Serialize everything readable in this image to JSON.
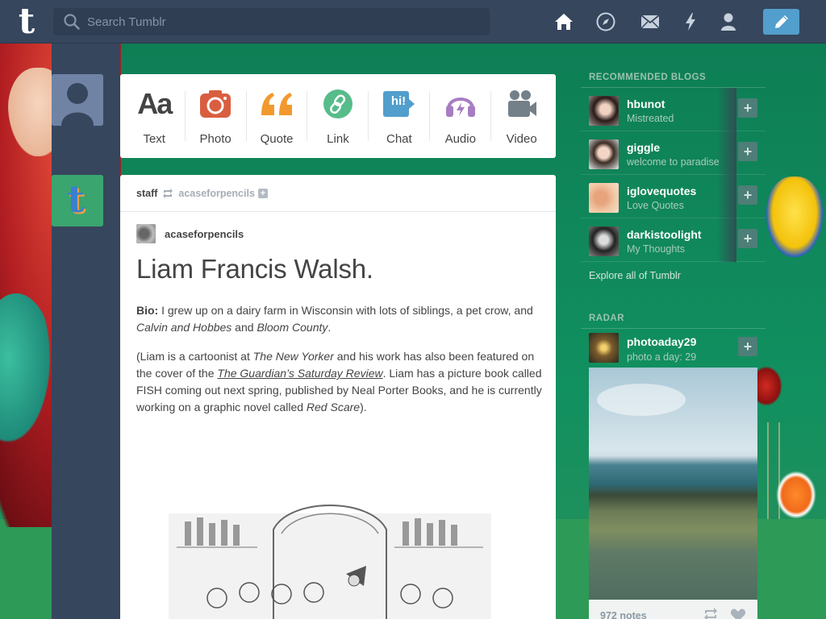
{
  "search": {
    "placeholder": "Search Tumblr"
  },
  "nav": {
    "icons": [
      "home-icon",
      "explore-icon",
      "inbox-icon",
      "activity-icon",
      "account-icon"
    ],
    "compose": "pencil-icon"
  },
  "post_types": [
    {
      "label": "Text",
      "icon": "Aa",
      "color": "#444444"
    },
    {
      "label": "Photo",
      "icon": "camera-icon",
      "color": "#d95e40"
    },
    {
      "label": "Quote",
      "icon": "quote-icon",
      "color": "#f2992e"
    },
    {
      "label": "Link",
      "icon": "link-icon",
      "color": "#56bc8a"
    },
    {
      "label": "Chat",
      "icon": "hi!",
      "color": "#529ecc"
    },
    {
      "label": "Audio",
      "icon": "headphones-icon",
      "color": "#a77dc2"
    },
    {
      "label": "Video",
      "icon": "video-camera-icon",
      "color": "#748089"
    }
  ],
  "post": {
    "reblogger": "staff",
    "reblogged_from": "acaseforpencils",
    "source": "acaseforpencils",
    "title": "Liam Francis Walsh.",
    "bio_label": "Bio:",
    "bio_text": " I grew up on a dairy farm in Wisconsin with lots of siblings, a pet crow, and ",
    "bio_italic1": "Calvin and Hobbes",
    "bio_and": " and ",
    "bio_italic2": "Bloom County",
    "bio_end": ".",
    "p2_a": "(Liam is a cartoonist at ",
    "p2_newyorker": "The New Yorker",
    "p2_b": " and his work has also been featured on the cover of the ",
    "p2_guardian": "The Guardian’s Saturday Review",
    "p2_c": ". Liam has a picture book called FISH coming out next spring, published by Neal Porter Books, and he is currently working on a graphic novel called ",
    "p2_redscare": "Red Scare",
    "p2_d": ")."
  },
  "sidebar": {
    "recommended_title": "RECOMMENDED BLOGS",
    "blogs": [
      {
        "name": "hbunot",
        "subtitle": "Mistreated"
      },
      {
        "name": "giggle",
        "subtitle": "welcome to paradise"
      },
      {
        "name": "iglovequotes",
        "subtitle": "Love Quotes"
      },
      {
        "name": "darkistoolight",
        "subtitle": "My Thoughts"
      }
    ],
    "explore_link": "Explore all of Tumblr",
    "radar_title": "RADAR",
    "radar": {
      "name": "photoaday29",
      "subtitle": "photo a day: 29",
      "notes": "972 notes"
    }
  },
  "colors": {
    "header": "#36465d",
    "accent": "#529ecc"
  }
}
